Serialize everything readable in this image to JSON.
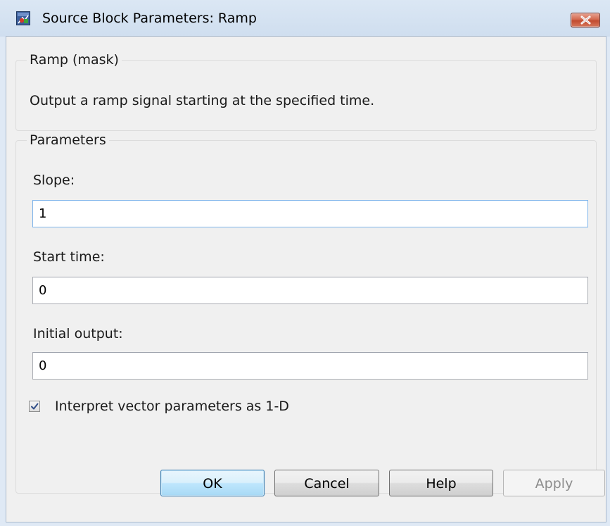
{
  "window": {
    "title": "Source Block Parameters: Ramp",
    "icon": "simulink-block-icon",
    "close_icon": "close-x-icon"
  },
  "mask_group": {
    "legend": "Ramp (mask)",
    "description": "Output a ramp signal starting at the specified time."
  },
  "parameters_group": {
    "legend": "Parameters",
    "fields": [
      {
        "label": "Slope:",
        "value": "1"
      },
      {
        "label": "Start time:",
        "value": "0"
      },
      {
        "label": "Initial output:",
        "value": "0"
      }
    ],
    "checkbox": {
      "label": "Interpret vector parameters as 1-D",
      "checked": true
    }
  },
  "buttons": {
    "ok": "OK",
    "cancel": "Cancel",
    "help": "Help",
    "apply": "Apply"
  },
  "colors": {
    "close_button": "#c24b2f",
    "default_button_border": "#3c7fb1",
    "focused_field_border": "#7eb4ea"
  }
}
